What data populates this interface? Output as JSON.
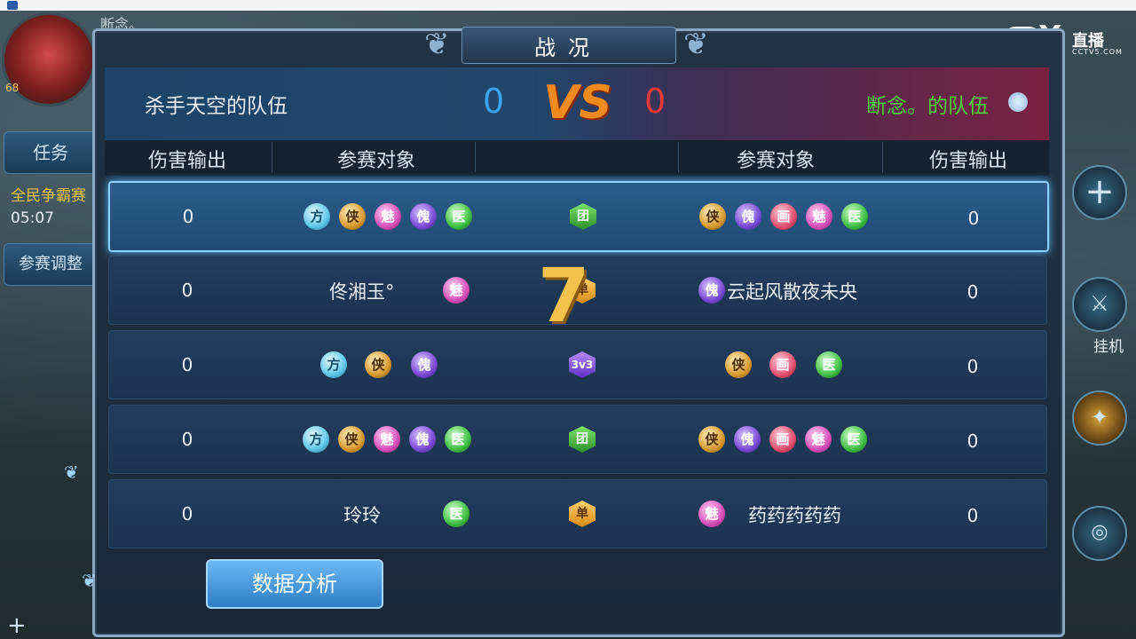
{
  "top_left_name": "断念。",
  "avatar_level": "68",
  "left_buttons": {
    "task": "任务",
    "adjust": "参赛调整"
  },
  "left_event": {
    "name": "全民争霸赛",
    "time": "05:07"
  },
  "right_menu": {
    "plus_icon": "plus-icon",
    "hangup_label": "挂机"
  },
  "watermark": {
    "brand": "直播",
    "domain": "CCTV5.COM"
  },
  "panel": {
    "title": "战况",
    "left_team": "杀手天空的队伍",
    "left_score": "0",
    "vs": "VS",
    "right_score": "0",
    "right_team": "断念。的队伍",
    "headers": {
      "left_damage": "伤害输出",
      "left_participants": "参赛对象",
      "right_participants": "参赛对象",
      "right_damage": "伤害输出"
    },
    "rows": [
      {
        "left_damage": "0",
        "left_player": "",
        "left_badges": [
          "方",
          "侠",
          "魅",
          "傀",
          "医"
        ],
        "mode": "团",
        "right_badges": [
          "侠",
          "傀",
          "画",
          "魅",
          "医"
        ],
        "right_player": "",
        "right_damage": "0"
      },
      {
        "left_damage": "0",
        "left_player": "佟湘玉°",
        "left_badges": [
          "魅"
        ],
        "mode": "单",
        "right_badges": [
          "傀"
        ],
        "right_player": "云起风散夜未央",
        "right_damage": "0"
      },
      {
        "left_damage": "0",
        "left_player": "",
        "left_badges": [
          "方",
          "侠",
          "傀"
        ],
        "mode": "3v3",
        "right_badges": [
          "侠",
          "画",
          "医"
        ],
        "right_player": "",
        "right_damage": "0"
      },
      {
        "left_damage": "0",
        "left_player": "",
        "left_badges": [
          "方",
          "侠",
          "魅",
          "傀",
          "医"
        ],
        "mode": "团",
        "right_badges": [
          "侠",
          "傀",
          "画",
          "魅",
          "医"
        ],
        "right_player": "",
        "right_damage": "0"
      },
      {
        "left_damage": "0",
        "left_player": "玲玲",
        "left_badges": [
          "医"
        ],
        "mode": "单",
        "right_badges": [
          "魅"
        ],
        "right_player": "药药药药药",
        "right_damage": "0"
      }
    ],
    "round_counter": "7",
    "analysis_button": "数据分析"
  }
}
